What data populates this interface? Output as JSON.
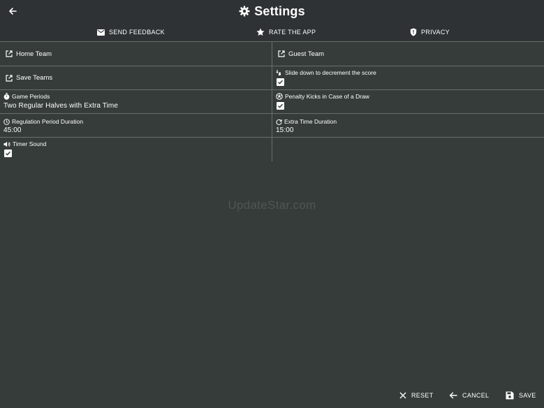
{
  "header": {
    "title": "Settings",
    "back_icon": "arrow-left-icon",
    "title_icon": "gear-icon"
  },
  "toolbar": {
    "feedback_label": "SEND FEEDBACK",
    "rate_label": "RATE THE APP",
    "privacy_label": "PRIVACY"
  },
  "settings": {
    "home_team": "Home Team",
    "guest_team": "Guest Team",
    "save_teams": "Save Teams",
    "slide_down": {
      "label": "Slide down to decrement the score",
      "checked": true
    },
    "game_periods": {
      "label": "Game Periods",
      "value": "Two Regular Halves with Extra Time"
    },
    "penalty_kicks": {
      "label": "Penalty Kicks in Case of a Draw",
      "checked": true
    },
    "regulation_duration": {
      "label": "Regulation Period Duration",
      "value": "45:00"
    },
    "extra_time_duration": {
      "label": "Extra Time Duration",
      "value": "15:00"
    },
    "timer_sound": {
      "label": "Timer Sound",
      "checked": true
    }
  },
  "watermark": "UpdateStar.com",
  "footer": {
    "reset_label": "RESET",
    "cancel_label": "CANCEL",
    "save_label": "SAVE"
  },
  "colors": {
    "background": "#353c3a",
    "header_background": "#2e3234",
    "divider": "#6a6f6e",
    "text": "#ffffff"
  }
}
